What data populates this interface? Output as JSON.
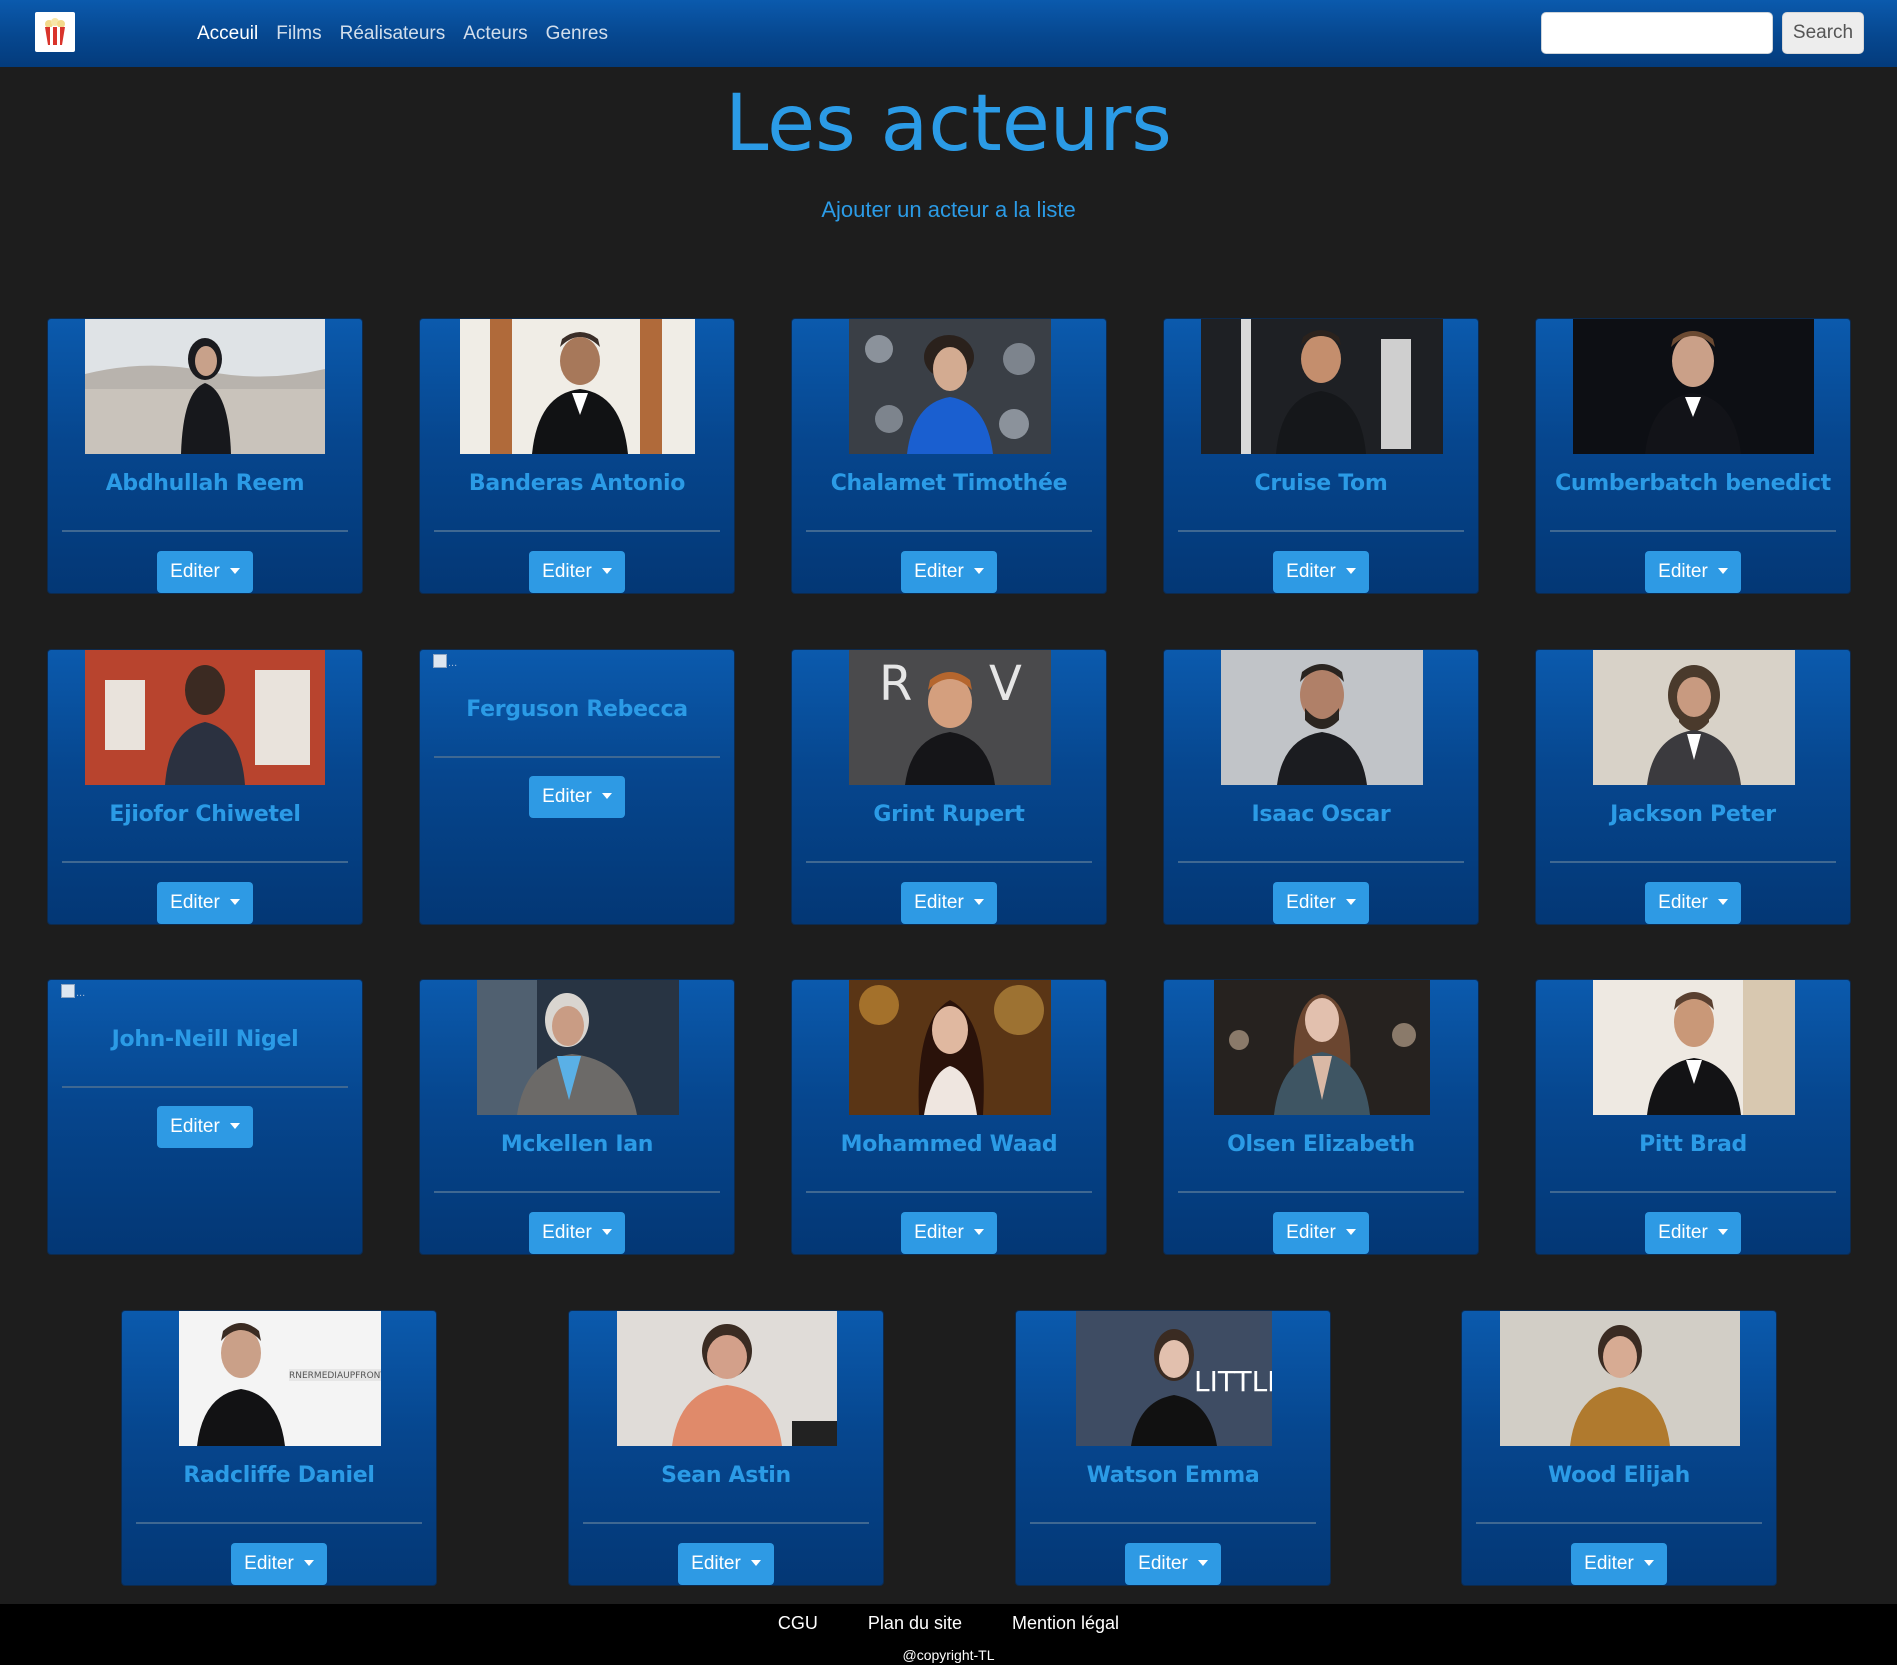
{
  "navbar": {
    "brand_icon": "popcorn-icon",
    "links": [
      {
        "label": "Acceuil",
        "active": true
      },
      {
        "label": "Films",
        "active": false
      },
      {
        "label": "Réalisateurs",
        "active": false
      },
      {
        "label": "Acteurs",
        "active": false
      },
      {
        "label": "Genres",
        "active": false
      }
    ],
    "search": {
      "value": "",
      "placeholder": "",
      "button_label": "Search"
    }
  },
  "page": {
    "title": "Les acteurs",
    "add_link": "Ajouter un acteur a la liste"
  },
  "colors": {
    "accent": "#2b9be6",
    "navbar": "#06478f",
    "background": "#1d1d1d",
    "card": "#06468e",
    "button": "#2e9ae4",
    "footer": "#000000"
  },
  "actors": [
    {
      "name": "Abdhullah Reem",
      "has_photo": true,
      "edit_label": "Editer"
    },
    {
      "name": "Banderas Antonio",
      "has_photo": true,
      "edit_label": "Editer"
    },
    {
      "name": "Chalamet Timothée",
      "has_photo": true,
      "edit_label": "Editer"
    },
    {
      "name": "Cruise Tom",
      "has_photo": true,
      "edit_label": "Editer"
    },
    {
      "name": "Cumberbatch benedict",
      "has_photo": true,
      "edit_label": "Editer"
    },
    {
      "name": "Ejiofor Chiwetel",
      "has_photo": true,
      "edit_label": "Editer"
    },
    {
      "name": "Ferguson Rebecca",
      "has_photo": false,
      "broken_alt": "...",
      "edit_label": "Editer"
    },
    {
      "name": "Grint Rupert",
      "has_photo": true,
      "edit_label": "Editer"
    },
    {
      "name": "Isaac Oscar",
      "has_photo": true,
      "edit_label": "Editer"
    },
    {
      "name": "Jackson Peter",
      "has_photo": true,
      "edit_label": "Editer"
    },
    {
      "name": "John-Neill Nigel",
      "has_photo": false,
      "broken_alt": "...",
      "edit_label": "Editer"
    },
    {
      "name": "Mckellen Ian",
      "has_photo": true,
      "edit_label": "Editer"
    },
    {
      "name": "Mohammed Waad",
      "has_photo": true,
      "edit_label": "Editer"
    },
    {
      "name": "Olsen Elizabeth",
      "has_photo": true,
      "edit_label": "Editer"
    },
    {
      "name": "Pitt Brad",
      "has_photo": true,
      "edit_label": "Editer"
    },
    {
      "name": "Radcliffe Daniel",
      "has_photo": true,
      "edit_label": "Editer"
    },
    {
      "name": "Sean Astin",
      "has_photo": true,
      "edit_label": "Editer"
    },
    {
      "name": "Watson Emma",
      "has_photo": true,
      "edit_label": "Editer"
    },
    {
      "name": "Wood Elijah",
      "has_photo": true,
      "edit_label": "Editer"
    }
  ],
  "footer": {
    "links": [
      "CGU",
      "Plan du site",
      "Mention légal"
    ],
    "copyright": "@copyright-TL"
  }
}
